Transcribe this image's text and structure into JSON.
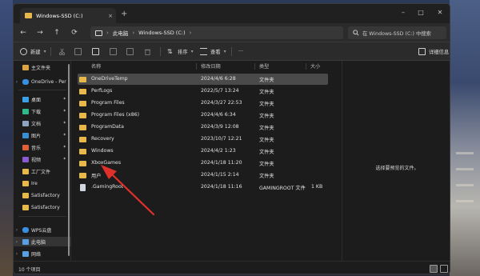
{
  "titlebar": {
    "tab_label": "Windows-SSD (C:)",
    "tab_close": "×",
    "new_tab": "+",
    "minimize": "–",
    "maximize": "□",
    "close": "✕"
  },
  "navigation": {
    "back": "←",
    "forward": "→",
    "up": "↑",
    "refresh": "⟳",
    "breadcrumb": [
      "此电脑",
      "Windows-SSD (C:)"
    ],
    "breadcrumb_sep": "›",
    "more": "›",
    "search_placeholder": "在 Windows-SSD (C:) 中搜索"
  },
  "commandbar": {
    "new_label": "新建",
    "sort_label": "排序",
    "view_label": "查看",
    "more_label": "···",
    "details_label": "详细信息"
  },
  "sidebar": {
    "items": [
      {
        "label": "主文件夹",
        "icon": "home-icon"
      },
      {
        "label": "OneDrive - Per",
        "icon": "cloud-icon",
        "expandable": true
      },
      {
        "label": "桌面",
        "icon": "desktop-icon",
        "pin": "✦"
      },
      {
        "label": "下载",
        "icon": "download-icon",
        "pin": "✦"
      },
      {
        "label": "文档",
        "icon": "document-icon",
        "pin": "✦"
      },
      {
        "label": "图片",
        "icon": "picture-icon",
        "pin": "✦"
      },
      {
        "label": "音乐",
        "icon": "music-icon",
        "pin": "✦"
      },
      {
        "label": "视频",
        "icon": "video-icon",
        "pin": "✦"
      },
      {
        "label": "工厂文件",
        "icon": "folder-icon"
      },
      {
        "label": "Ire",
        "icon": "folder-icon"
      },
      {
        "label": "Satisfactory",
        "icon": "folder-icon"
      },
      {
        "label": "Satisfactory",
        "icon": "folder-icon"
      },
      {
        "label": "WPS云盘",
        "icon": "cloud-icon",
        "expandable": true
      },
      {
        "label": "此电脑",
        "icon": "pc-icon",
        "expandable": true
      },
      {
        "label": "网络",
        "icon": "network-icon",
        "expandable": true
      }
    ]
  },
  "table": {
    "headers": {
      "name": "名称",
      "date": "修改日期",
      "type": "类型",
      "size": "大小"
    },
    "rows": [
      {
        "name": "OneDriveTemp",
        "date": "2024/4/6 6:28",
        "type": "文件夹",
        "size": "",
        "kind": "folder",
        "selected": true
      },
      {
        "name": "PerfLogs",
        "date": "2022/5/7 13:24",
        "type": "文件夹",
        "size": "",
        "kind": "folder"
      },
      {
        "name": "Program Files",
        "date": "2024/3/27 22:53",
        "type": "文件夹",
        "size": "",
        "kind": "folder"
      },
      {
        "name": "Program Files (x86)",
        "date": "2024/4/6 6:34",
        "type": "文件夹",
        "size": "",
        "kind": "folder"
      },
      {
        "name": "ProgramData",
        "date": "2024/3/9 12:08",
        "type": "文件夹",
        "size": "",
        "kind": "folder"
      },
      {
        "name": "Recovery",
        "date": "2023/10/7 12:21",
        "type": "文件夹",
        "size": "",
        "kind": "folder"
      },
      {
        "name": "Windows",
        "date": "2024/4/2 1:23",
        "type": "文件夹",
        "size": "",
        "kind": "folder"
      },
      {
        "name": "XboxGames",
        "date": "2024/1/18 11:20",
        "type": "文件夹",
        "size": "",
        "kind": "folder"
      },
      {
        "name": "用户",
        "date": "2024/1/15 2:14",
        "type": "文件夹",
        "size": "",
        "kind": "folder"
      },
      {
        "name": ".GamingRoot",
        "date": "2024/1/18 11:16",
        "type": "GAMINGROOT 文件",
        "size": "1 KB",
        "kind": "file"
      }
    ]
  },
  "preview": {
    "message": "选择要预览的文件。"
  },
  "statusbar": {
    "count": "10 个项目"
  },
  "colors": {
    "folder": "#e9b84b",
    "selection": "#4a4a4a",
    "annotation_arrow": "#e0302a"
  }
}
